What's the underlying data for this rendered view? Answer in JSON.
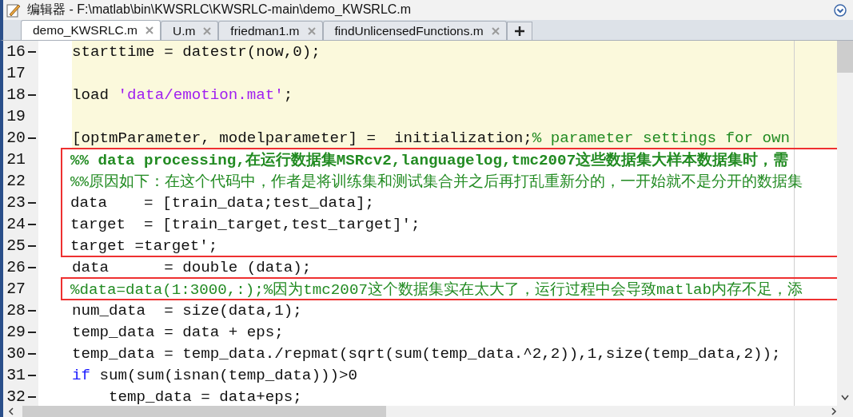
{
  "window": {
    "title": "编辑器 - F:\\matlab\\bin\\KWSRLC\\KWSRLC-main\\demo_KWSRLC.m"
  },
  "tabs": [
    {
      "label": "demo_KWSRLC.m",
      "selected": true
    },
    {
      "label": "U.m",
      "selected": false
    },
    {
      "label": "friedman1.m",
      "selected": false
    },
    {
      "label": "findUnlicensedFunctions.m",
      "selected": false
    }
  ],
  "blocks": [
    {
      "kind": "cell",
      "lines": [
        {
          "number": "16",
          "executable": true,
          "tokens": [
            {
              "kind": "plain",
              "text": "starttime = datestr(now,0);"
            }
          ]
        },
        {
          "number": "17",
          "executable": false
        },
        {
          "number": "18",
          "executable": true,
          "tokens": [
            {
              "kind": "plain",
              "text": "load "
            },
            {
              "kind": "string",
              "text": "'data/emotion.mat'"
            },
            {
              "kind": "plain",
              "text": ";"
            }
          ]
        },
        {
          "number": "19",
          "executable": false
        },
        {
          "number": "20",
          "executable": true,
          "tokens": [
            {
              "kind": "plain",
              "text": "[optmParameter, modelparameter] =  initialization;"
            },
            {
              "kind": "comment",
              "text": "% parameter settings for own"
            }
          ]
        }
      ]
    },
    {
      "kind": "boxed",
      "lines": [
        {
          "number": "21",
          "executable": false,
          "tokens": [
            {
              "kind": "cell_title",
              "text": "%% data processing,在运行数据集MSRcv2,languagelog,tmc2007这些数据集大样本数据集时，需"
            }
          ]
        },
        {
          "number": "22",
          "executable": false,
          "tokens": [
            {
              "kind": "comment",
              "text": "%%原因如下：在这个代码中，作者是将训练集和测试集合并之后再打乱重新分的，一开始就不是分开的数据集"
            }
          ]
        },
        {
          "number": "23",
          "executable": true,
          "tokens": [
            {
              "kind": "plain",
              "text": "data    = [train_data;test_data];"
            }
          ]
        },
        {
          "number": "24",
          "executable": true,
          "tokens": [
            {
              "kind": "plain",
              "text": "target  = [train_target,test_target]';"
            }
          ]
        },
        {
          "number": "25",
          "executable": true,
          "tokens": [
            {
              "kind": "plain",
              "text": "target =target';"
            }
          ]
        }
      ]
    },
    {
      "kind": "plain",
      "lines": [
        {
          "number": "26",
          "executable": true,
          "tokens": [
            {
              "kind": "plain",
              "text": "data      = double (data);"
            }
          ]
        }
      ]
    },
    {
      "kind": "boxed",
      "lines": [
        {
          "number": "27",
          "executable": false,
          "tokens": [
            {
              "kind": "comment",
              "text": "%data=data(1:3000,:);%因为tmc2007这个数据集实在太大了，运行过程中会导致matlab内存不足，添"
            }
          ]
        }
      ]
    },
    {
      "kind": "plain",
      "lines": [
        {
          "number": "28",
          "executable": true,
          "tokens": [
            {
              "kind": "plain",
              "text": "num_data  = size(data,1);"
            }
          ]
        },
        {
          "number": "29",
          "executable": true,
          "tokens": [
            {
              "kind": "plain",
              "text": "temp_data = data + eps;"
            }
          ]
        },
        {
          "number": "30",
          "executable": true,
          "tokens": [
            {
              "kind": "plain",
              "text": "temp_data = temp_data./repmat(sqrt(sum(temp_data.^2,2)),1,size(temp_data,2));"
            }
          ]
        },
        {
          "number": "31",
          "executable": true,
          "tokens": [
            {
              "kind": "keyword",
              "text": "if"
            },
            {
              "kind": "plain",
              "text": " sum(sum(isnan(temp_data)))>0"
            }
          ]
        },
        {
          "number": "32",
          "executable": true,
          "tokens": [
            {
              "kind": "plain",
              "text": "    temp_data = data+eps;"
            }
          ]
        }
      ]
    }
  ]
}
